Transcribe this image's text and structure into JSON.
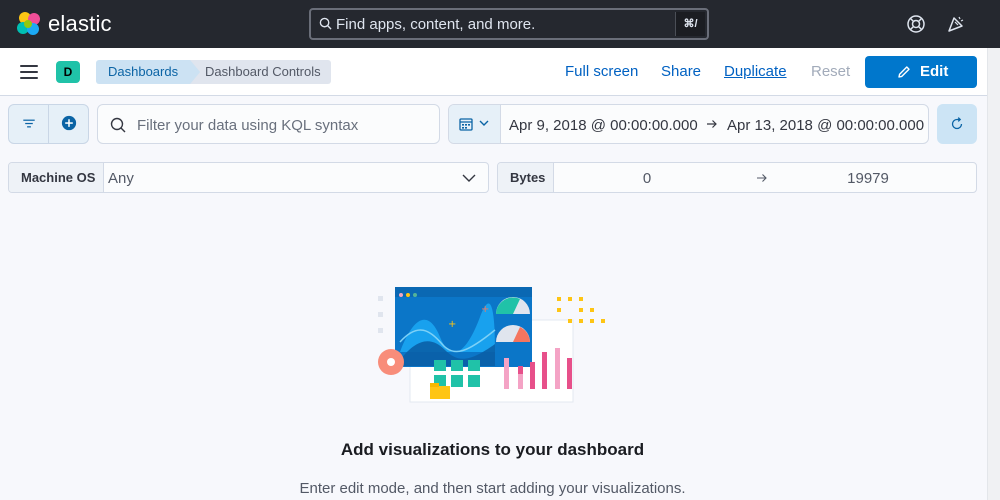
{
  "header": {
    "brand": "elastic",
    "search_placeholder": "Find apps, content, and more.",
    "search_shortcut": "⌘/",
    "icons": [
      "elastic-logo-icon",
      "help-icon",
      "newsfeed-icon"
    ]
  },
  "subheader": {
    "space_initial": "D",
    "breadcrumbs": [
      "Dashboards",
      "Dashboard Controls"
    ],
    "actions": {
      "full_screen": "Full screen",
      "share": "Share",
      "duplicate": "Duplicate",
      "reset": "Reset",
      "edit": "Edit"
    }
  },
  "query_bar": {
    "kql_placeholder": "Filter your data using KQL syntax",
    "date_start": "Apr 9, 2018 @ 00:00:00.000",
    "date_end": "Apr 13, 2018 @ 00:00:00.000"
  },
  "controls": {
    "machine_os": {
      "label": "Machine OS",
      "value": "Any"
    },
    "bytes": {
      "label": "Bytes",
      "min": "0",
      "max": "19979"
    }
  },
  "empty_state": {
    "title": "Add visualizations to your dashboard",
    "description": "Enter edit mode, and then start adding your visualizations."
  },
  "colors": {
    "header_bg": "#25282f",
    "primary": "#0077cc",
    "link": "#0061c2",
    "space_badge": "#20c2a8",
    "breadcrumb_active": "#cce2f3"
  }
}
